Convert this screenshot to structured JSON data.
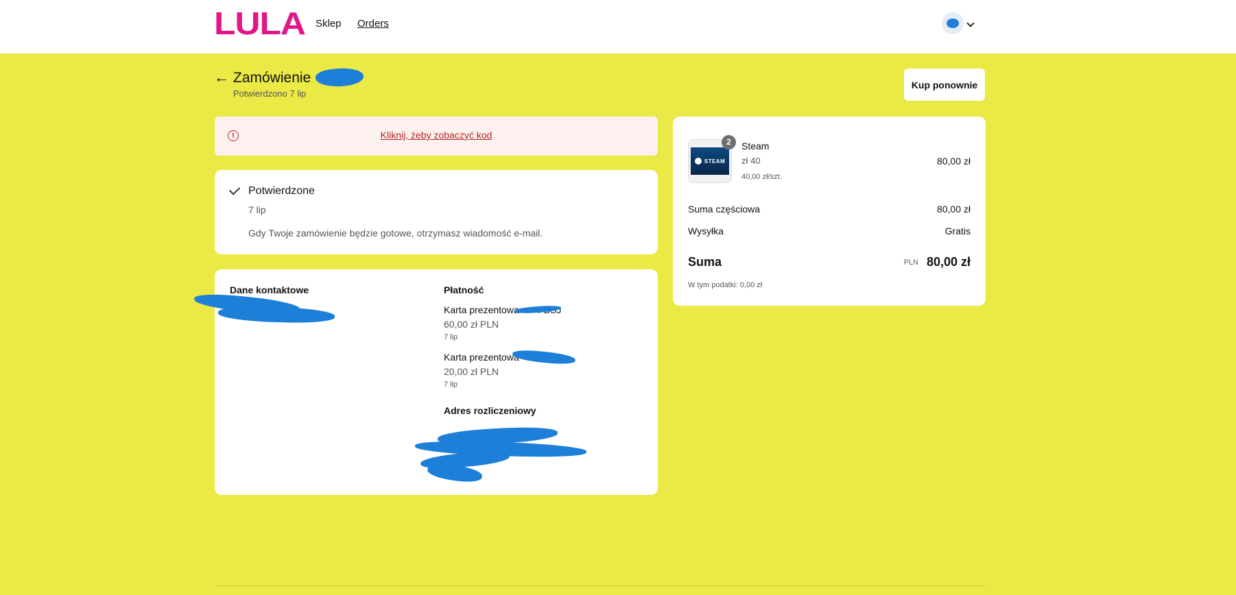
{
  "header": {
    "logo": "LULA",
    "nav": {
      "shop": "Sklep",
      "orders": "Orders"
    }
  },
  "order": {
    "title": "Zamówienie",
    "subtitle": "Potwierdzono 7 lip",
    "buy_again": "Kup ponownie"
  },
  "alert": {
    "icon": "!",
    "link": "Kliknij, żeby zobaczyć kod"
  },
  "status": {
    "title": "Potwierdzone",
    "date": "7 lip",
    "message": "Gdy Twoje zamówienie będzie gotowe, otrzymasz wiadomość e-mail."
  },
  "details": {
    "contact_heading": "Dane kontaktowe",
    "payment_heading": "Płatność",
    "payments": [
      {
        "method": "Karta prezentowa •••• FBSJ",
        "amount": "60,00 zł PLN",
        "date": "7 lip"
      },
      {
        "method": "Karta prezentowa •••",
        "amount": "20,00 zł PLN",
        "date": "7 lip"
      }
    ],
    "billing_heading": "Adres rozliczeniowy"
  },
  "summary": {
    "product": {
      "quantity": "2",
      "thumb_label": "STEAM",
      "name": "Steam",
      "variant": "zł 40",
      "unit_price": "40,00 zł/szt.",
      "price": "80,00 zł"
    },
    "subtotal_label": "Suma częściowa",
    "subtotal_value": "80,00 zł",
    "shipping_label": "Wysyłka",
    "shipping_value": "Gratis",
    "total_label": "Suma",
    "total_currency": "PLN",
    "total_value": "80,00 zł",
    "tax_note": "W tym podatki: 0,00 zł"
  },
  "colors": {
    "background": "#ebe945",
    "brand": "#e0178a",
    "alert_text": "#b3261e",
    "redaction": "#1d7fd8"
  }
}
